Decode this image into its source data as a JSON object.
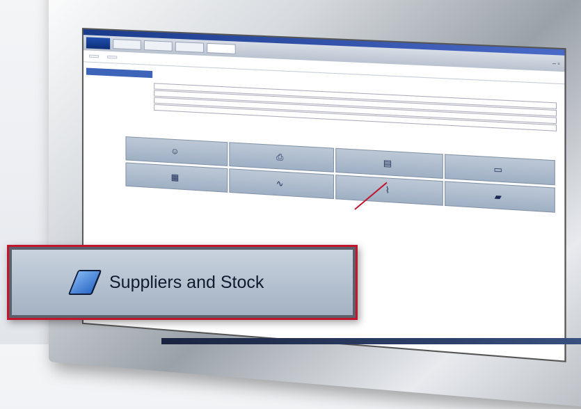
{
  "app": {
    "logo_text": "",
    "menu_tabs": [
      "",
      "",
      "",
      ""
    ],
    "toolbar": [
      "",
      ""
    ],
    "section_tab": ""
  },
  "form": {
    "rows": [
      {
        "label": "",
        "value": ""
      },
      {
        "label": "",
        "value": ""
      },
      {
        "label": "",
        "value": ""
      },
      {
        "label": "",
        "value": ""
      }
    ]
  },
  "grid_buttons": [
    [
      {
        "icon": "person-icon",
        "label": ""
      },
      {
        "icon": "printer-icon",
        "label": ""
      },
      {
        "icon": "document-icon",
        "label": ""
      },
      {
        "icon": "folder-icon",
        "label": ""
      }
    ],
    [
      {
        "icon": "calculator-icon",
        "label": ""
      },
      {
        "icon": "signature-icon",
        "label": ""
      },
      {
        "icon": "chart-icon",
        "label": ""
      },
      {
        "icon": "book-icon",
        "label": ""
      }
    ]
  ],
  "callout": {
    "label": "Suppliers and Stock",
    "icon": "book-icon",
    "border_color": "#c0172f"
  }
}
